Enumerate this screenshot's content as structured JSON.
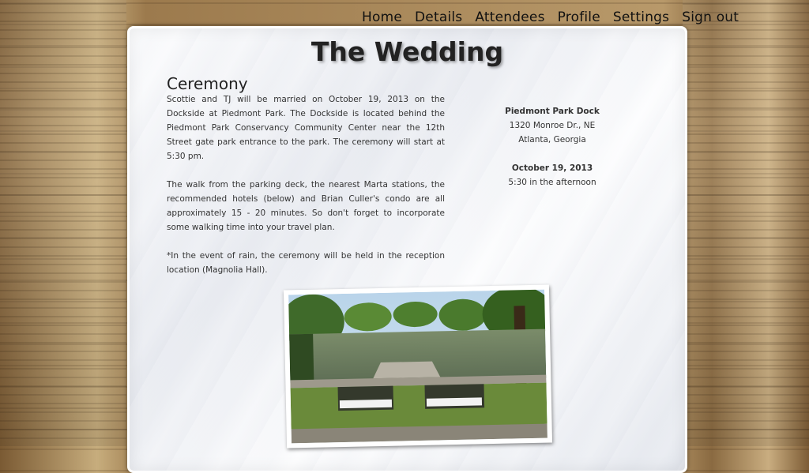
{
  "nav": {
    "items": [
      {
        "label": "Home"
      },
      {
        "label": "Details"
      },
      {
        "label": "Attendees"
      },
      {
        "label": "Profile"
      },
      {
        "label": "Settings"
      },
      {
        "label": "Sign out"
      }
    ]
  },
  "page": {
    "title": "The Wedding",
    "section_heading": "Ceremony",
    "paragraphs": [
      "Scottie and TJ will be married on October 19, 2013 on the Dockside at Piedmont Park. The Dockside is located behind the Piedmont Park Conservancy Community Center near the 12th Street gate park entrance to the park. The ceremony will start at 5:30 pm.",
      "The walk from the parking deck, the nearest Marta stations, the recommended hotels (below) and Brian Culler's condo are all approximately 15 - 20 minutes. So don't forget to incorporate some walking time into your travel plan.",
      "*In the event of rain, the ceremony will be held in the reception location (Magnolia Hall)."
    ]
  },
  "details": {
    "venue_name": "Piedmont Park Dock",
    "address_line1": "1320 Monroe Dr., NE",
    "address_line2": "Atlanta, Georgia",
    "date": "October 19, 2013",
    "time": "5:30 in the afternoon"
  },
  "colors": {
    "text": "#333333",
    "heading": "#222222",
    "nav": "#111111"
  }
}
